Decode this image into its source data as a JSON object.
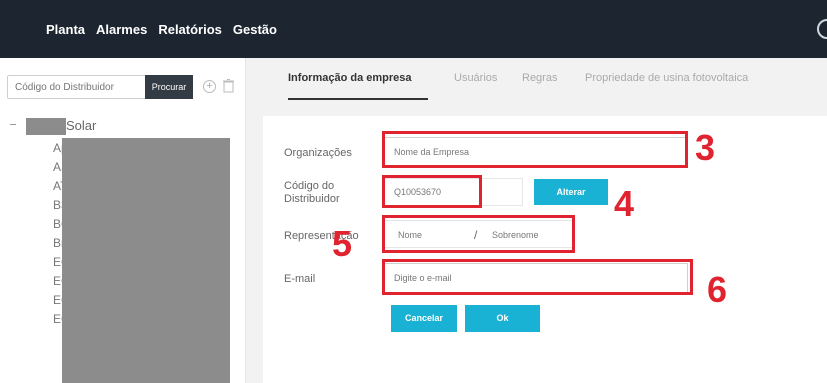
{
  "topbar": {
    "nav": [
      "Planta",
      "Alarmes",
      "Relatórios",
      "Gestão"
    ]
  },
  "sidebar": {
    "search_placeholder": "Código do Distribuidor",
    "search_button": "Procurar",
    "tree_root": "Solar",
    "tree_items": [
      "Ap",
      "AS",
      "AT",
      "B3",
      "BG",
      "Br",
      "EC",
      "EC",
      "EC",
      "EC"
    ]
  },
  "tabs": [
    "Informação da empresa",
    "Usuários",
    "Regras",
    "Propriedade de usina fotovoltaica"
  ],
  "form": {
    "org_label": "Organizações",
    "org_value": "Nome da Empresa",
    "dist_label_line1": "Código do",
    "dist_label_line2": "Distribuidor",
    "dist_value": "Q10053670",
    "alterar": "Alterar",
    "rep_label": "Representação",
    "first_name": "Nome",
    "separator": "/",
    "last_name": "Sobrenome",
    "email_label": "E-mail",
    "email_value": "Digite o e-mail",
    "cancel": "Cancelar",
    "ok": "Ok"
  },
  "annotations": [
    "3",
    "4",
    "5",
    "6"
  ],
  "colors": {
    "topbar": "#1d2630",
    "accent": "#1ab2d4",
    "annotation": "#e0242f"
  }
}
